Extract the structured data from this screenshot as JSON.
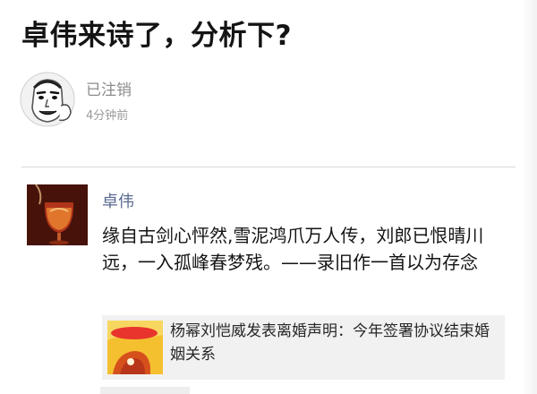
{
  "post": {
    "title": "卓伟来诗了，分析下?",
    "author": "已注销",
    "time": "4分钟前"
  },
  "moment": {
    "name": "卓伟",
    "text": "缘自古剑心怦然,雪泥鸿爪万人传，刘郎已恨晴川远，一入孤峰春梦残。——录旧作一首以为存念",
    "link_title": "杨幂刘恺威发表离婚声明：今年签署协议结束婚姻关系"
  },
  "colors": {
    "name_link": "#5a6a92",
    "meta_gray": "#9a9a9a",
    "card_bg": "#f1f1f1"
  }
}
